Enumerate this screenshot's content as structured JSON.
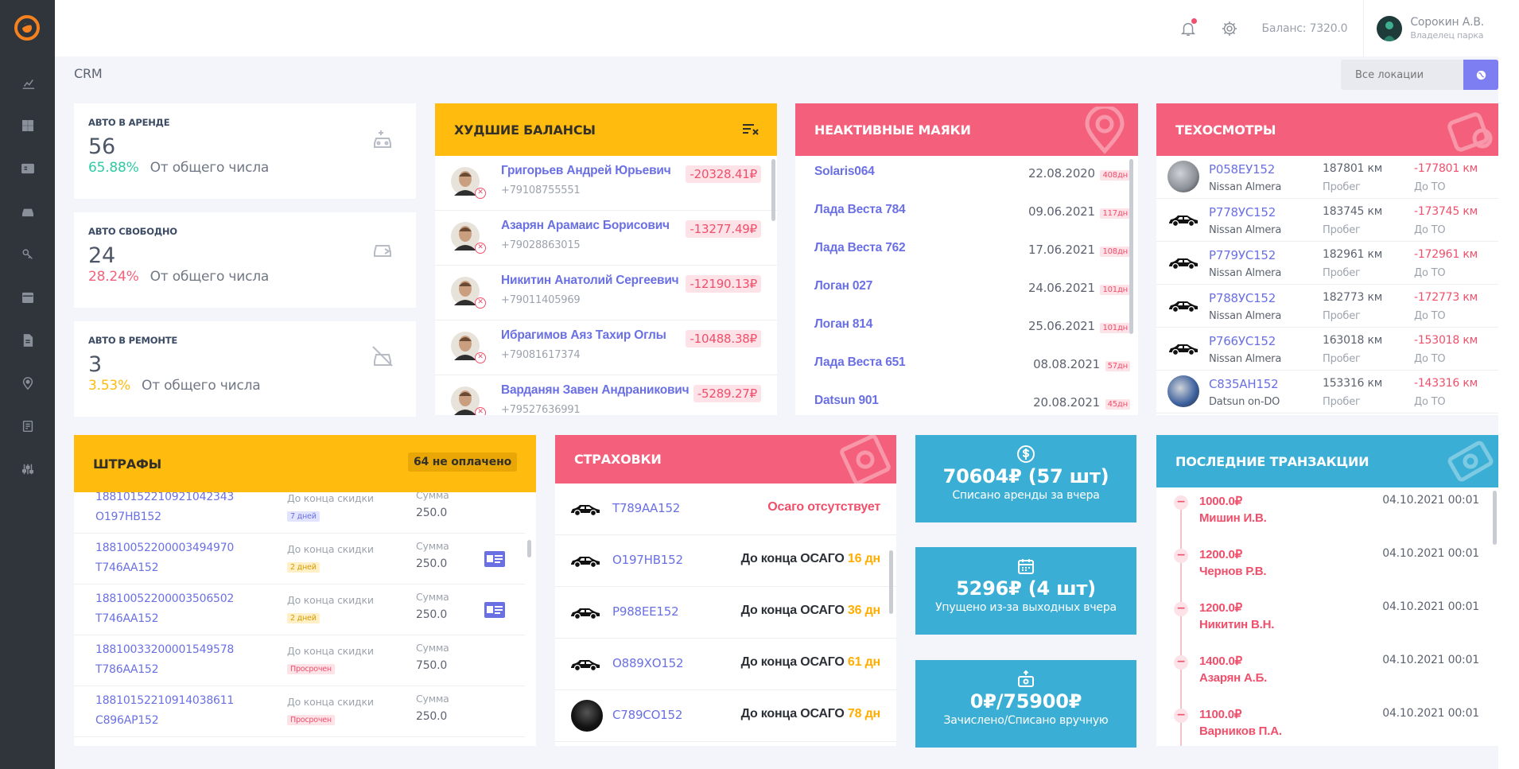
{
  "header": {
    "balance": "Баланс: 7320.0",
    "user_name": "Сорокин А.В.",
    "user_role": "Владелец парка"
  },
  "page_title": "CRM",
  "location": {
    "placeholder": "Все локации"
  },
  "sidebar": {
    "items": [
      "chart-icon",
      "dashboard-icon",
      "id-card-icon",
      "car-icon",
      "key-icon",
      "calendar-icon",
      "document-icon",
      "map-pin-icon",
      "report-icon",
      "sliders-icon"
    ]
  },
  "stats": [
    {
      "label": "Авто в аренде",
      "value": "56",
      "pct": "65.88%",
      "pct_color": "#2ecba4",
      "note": "От общего числа"
    },
    {
      "label": "Авто свободно",
      "value": "24",
      "pct": "28.24%",
      "pct_color": "#f4607b",
      "note": "От общего числа"
    },
    {
      "label": "Авто в ремонте",
      "value": "3",
      "pct": "3.53%",
      "pct_color": "#ffbb0e",
      "note": "От общего числа"
    }
  ],
  "worst_balances": {
    "title": "Худшие балансы",
    "rows": [
      {
        "name": "Григорьев Андрей Юрьевич",
        "phone": "+79108755551",
        "amount": "-20328.41₽"
      },
      {
        "name": "Азарян Арамаис Борисович",
        "phone": "+79028863015",
        "amount": "-13277.49₽"
      },
      {
        "name": "Никитин Анатолий Сергеевич",
        "phone": "+79011405969",
        "amount": "-12190.13₽"
      },
      {
        "name": "Ибрагимов Аяз Тахир Оглы",
        "phone": "+79081617374",
        "amount": "-10488.38₽"
      },
      {
        "name": "Варданян Завен Андраникович",
        "phone": "+79527636991",
        "amount": "-5289.27₽"
      }
    ]
  },
  "inactive_beacons": {
    "title": "Неактивные маяки",
    "rows": [
      {
        "name": "Solaris064",
        "date": "22.08.2020",
        "days": "408дн"
      },
      {
        "name": "Лада Веста 784",
        "date": "09.06.2021",
        "days": "117дн"
      },
      {
        "name": "Лада Веста 762",
        "date": "17.06.2021",
        "days": "108дн"
      },
      {
        "name": "Логан 027",
        "date": "24.06.2021",
        "days": "101дн"
      },
      {
        "name": "Логан 814",
        "date": "25.06.2021",
        "days": "101дн"
      },
      {
        "name": "Лада Веста 651",
        "date": "08.08.2021",
        "days": "57дн"
      },
      {
        "name": "Datsun 901",
        "date": "20.08.2021",
        "days": "45дн"
      }
    ]
  },
  "inspections": {
    "title": "Техосмотры",
    "mileage_label": "Пробег",
    "to_label": "До ТО",
    "rows": [
      {
        "plate": "Р058ЕУ152",
        "model": "Nissan Almera",
        "mileage": "187801 км",
        "to": "-177801 км",
        "img": "photo"
      },
      {
        "plate": "Р778УС152",
        "model": "Nissan Almera",
        "mileage": "183745 км",
        "to": "-173745 км",
        "img": "car"
      },
      {
        "plate": "Р779УС152",
        "model": "Nissan Almera",
        "mileage": "182961 км",
        "to": "-172961 км",
        "img": "car"
      },
      {
        "plate": "Р788УС152",
        "model": "Nissan Almera",
        "mileage": "182773 км",
        "to": "-172773 км",
        "img": "car"
      },
      {
        "plate": "Р766УС152",
        "model": "Nissan Almera",
        "mileage": "163018 км",
        "to": "-153018 км",
        "img": "car"
      },
      {
        "plate": "С835АН152",
        "model": "Datsun on-DO",
        "mileage": "153316 км",
        "to": "-143316 км",
        "img": "photo-blue"
      }
    ]
  },
  "fines": {
    "title": "Штрафы",
    "unpaid": "64 не оплачено",
    "discount_label": "До конца скидки",
    "sum_label": "Сумма",
    "rows": [
      {
        "num": "18810152210921042343",
        "plate": "О197НВ152",
        "badge": "7 дней",
        "badge_type": "blue",
        "sum": "250.0",
        "card": false
      },
      {
        "num": "18810052200003494970",
        "plate": "Т746АА152",
        "badge": "2 дней",
        "badge_type": "yel",
        "sum": "250.0",
        "card": true
      },
      {
        "num": "18810052200003506502",
        "plate": "Т746АА152",
        "badge": "2 дней",
        "badge_type": "yel",
        "sum": "250.0",
        "card": true
      },
      {
        "num": "18810033200001549578",
        "plate": "Т786АА152",
        "badge": "Просрочен",
        "badge_type": "red",
        "sum": "750.0",
        "card": false
      },
      {
        "num": "18810152210914038611",
        "plate": "С896АР152",
        "badge": "Просрочен",
        "badge_type": "red",
        "sum": "250.0",
        "card": false
      }
    ]
  },
  "insurance": {
    "title": "Страховки",
    "rows": [
      {
        "plate": "Т789АА152",
        "text": "Осаго отсутствует",
        "days": "",
        "missing": true,
        "img": "car"
      },
      {
        "plate": "О197НВ152",
        "text": "До конца ОСАГО",
        "days": "16 дн",
        "missing": false,
        "img": "car"
      },
      {
        "plate": "Р988ЕЕ152",
        "text": "До конца ОСАГО",
        "days": "36 дн",
        "missing": false,
        "img": "car"
      },
      {
        "plate": "О889ХО152",
        "text": "До конца ОСАГО",
        "days": "61 дн",
        "missing": false,
        "img": "car"
      },
      {
        "plate": "С789СО152",
        "text": "До конца ОСАГО",
        "days": "78 дн",
        "missing": false,
        "img": "photo"
      }
    ]
  },
  "summary_boxes": [
    {
      "icon": "dollar-icon",
      "value": "70604₽ (57 шт)",
      "text": "Списано аренды за вчера"
    },
    {
      "icon": "calendar-icon",
      "value": "5296₽ (4 шт)",
      "text": "Упущено из-за выходных вчера"
    },
    {
      "icon": "money-box-icon",
      "value": "0₽/75900₽",
      "text": "Зачислено/Списано вручную"
    }
  ],
  "transactions": {
    "title": "Последние транзакции",
    "rows": [
      {
        "amount": "1000.0₽",
        "name": "Мишин И.В.",
        "date": "04.10.2021 00:01"
      },
      {
        "amount": "1200.0₽",
        "name": "Чернов Р.В.",
        "date": "04.10.2021 00:01"
      },
      {
        "amount": "1200.0₽",
        "name": "Никитин В.Н.",
        "date": "04.10.2021 00:01"
      },
      {
        "amount": "1400.0₽",
        "name": "Азарян А.Б.",
        "date": "04.10.2021 00:01"
      },
      {
        "amount": "1100.0₽",
        "name": "Варников П.А.",
        "date": "04.10.2021 00:01"
      }
    ]
  }
}
